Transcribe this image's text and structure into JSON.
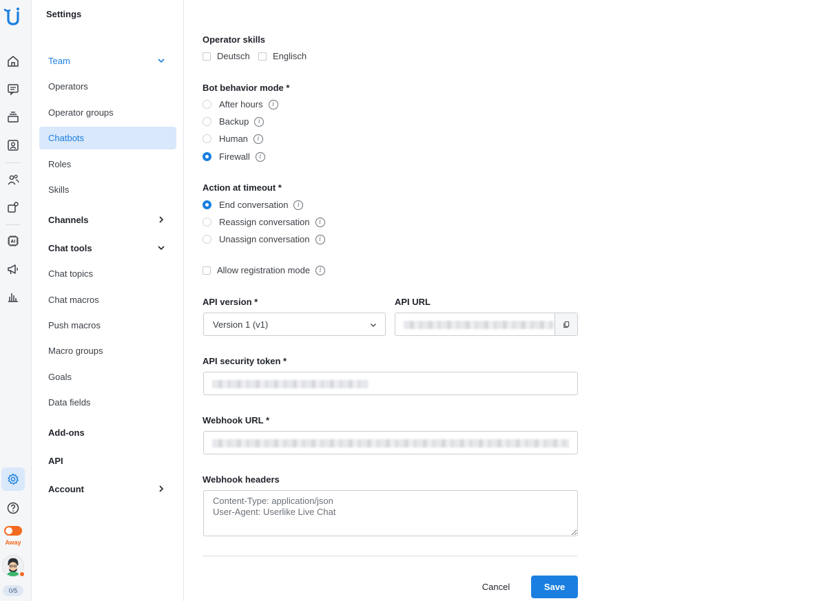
{
  "rail": {
    "status_label": "Away",
    "chat_count": "0/5",
    "accent": "#1a7fe0",
    "status_color": "#f26b22"
  },
  "sidebar": {
    "title": "Settings",
    "items": [
      {
        "label": "Team",
        "type": "section-expanded"
      },
      {
        "label": "Operators"
      },
      {
        "label": "Operator groups"
      },
      {
        "label": "Chatbots",
        "active": true
      },
      {
        "label": "Roles"
      },
      {
        "label": "Skills"
      },
      {
        "label": "Channels",
        "type": "section-collapsed"
      },
      {
        "label": "Chat tools",
        "type": "section-expanded"
      },
      {
        "label": "Chat topics"
      },
      {
        "label": "Chat macros"
      },
      {
        "label": "Push macros"
      },
      {
        "label": "Macro groups"
      },
      {
        "label": "Goals"
      },
      {
        "label": "Data fields"
      },
      {
        "label": "Add-ons",
        "type": "section"
      },
      {
        "label": "API",
        "type": "section"
      },
      {
        "label": "Account",
        "type": "section-collapsed"
      }
    ]
  },
  "form": {
    "operator_skills": {
      "label": "Operator skills",
      "options": [
        {
          "label": "Deutsch",
          "checked": false
        },
        {
          "label": "Englisch",
          "checked": false
        }
      ]
    },
    "bot_mode": {
      "label": "Bot behavior mode *",
      "options": [
        {
          "label": "After hours",
          "selected": false
        },
        {
          "label": "Backup",
          "selected": false
        },
        {
          "label": "Human",
          "selected": false
        },
        {
          "label": "Firewall",
          "selected": true
        }
      ]
    },
    "timeout": {
      "label": "Action at timeout *",
      "options": [
        {
          "label": "End conversation",
          "selected": true
        },
        {
          "label": "Reassign conversation",
          "selected": false
        },
        {
          "label": "Unassign conversation",
          "selected": false
        }
      ]
    },
    "registration": {
      "label": "Allow registration mode",
      "checked": false
    },
    "api_version": {
      "label": "API version *",
      "value": "Version 1 (v1)"
    },
    "api_url": {
      "label": "API URL"
    },
    "api_token": {
      "label": "API security token *"
    },
    "webhook_url": {
      "label": "Webhook URL *"
    },
    "webhook_headers": {
      "label": "Webhook headers",
      "placeholder": "Content-Type: application/json\nUser-Agent: Userlike Live Chat"
    },
    "info_glyph": "i",
    "cancel_label": "Cancel",
    "save_label": "Save"
  }
}
